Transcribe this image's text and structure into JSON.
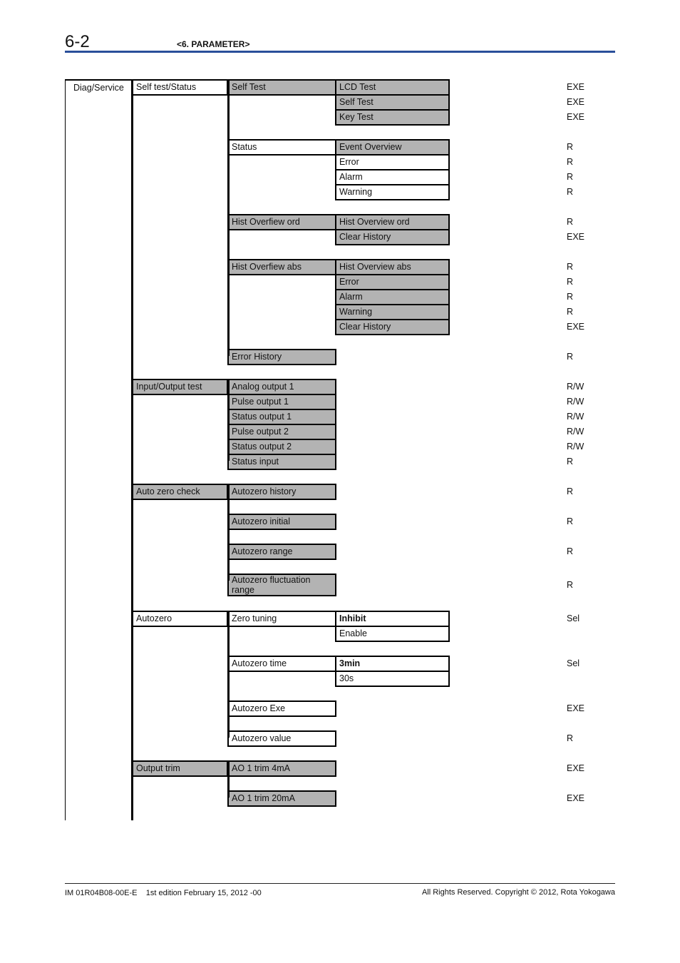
{
  "header": {
    "page_number": "6-2",
    "chapter": "<6. PARAMETER>"
  },
  "footer": {
    "document_id": "IM 01R04B08-00E-E    1st edition February 15, 2012 -00",
    "copyright": "All Rights Reserved. Copyright © 2012, Rota Yokogawa"
  },
  "colors": {
    "header_rule": "#2a4f9a",
    "menu_grey": "#b3b3b3"
  },
  "menu_tree": {
    "root": "Diag/Service",
    "level2": [
      {
        "label": "Self test/Status",
        "style": "white",
        "row": 0
      },
      {
        "label": "Input/Output test",
        "style": "grey",
        "row": 20
      },
      {
        "label": "Auto zero check",
        "style": "grey",
        "row": 27
      },
      {
        "label": "Autozero",
        "style": "white",
        "row": 35
      },
      {
        "label": "Output trim",
        "style": "grey",
        "row": 45
      }
    ],
    "level3": [
      {
        "label": "Self Test",
        "style": "grey",
        "row": 0
      },
      {
        "label": "Status",
        "style": "white",
        "row": 4
      },
      {
        "label": "Hist Overfiew ord",
        "style": "grey",
        "row": 9
      },
      {
        "label": "Hist Overfiew abs",
        "style": "grey",
        "row": 12
      },
      {
        "label": "Error History",
        "style": "grey",
        "row": 18
      },
      {
        "label": "Analog output 1",
        "style": "grey",
        "row": 20
      },
      {
        "label": "Pulse output 1",
        "style": "grey",
        "row": 21
      },
      {
        "label": "Status output 1",
        "style": "grey",
        "row": 22
      },
      {
        "label": "Pulse output 2",
        "style": "grey",
        "row": 23
      },
      {
        "label": "Status output 2",
        "style": "grey",
        "row": 24
      },
      {
        "label": "Status input",
        "style": "grey",
        "row": 25
      },
      {
        "label": "Autozero history",
        "style": "grey",
        "row": 27
      },
      {
        "label": "Autozero initial",
        "style": "grey",
        "row": 29
      },
      {
        "label": "Autozero range",
        "style": "grey",
        "row": 31
      },
      {
        "label": "Autozero fluctuation range",
        "style": "grey",
        "row": 33,
        "tall": true
      },
      {
        "label": "Zero tuning",
        "style": "white",
        "row": 35
      },
      {
        "label": "Autozero time",
        "style": "white",
        "row": 38
      },
      {
        "label": "Autozero Exe",
        "style": "white",
        "row": 41
      },
      {
        "label": "Autozero value",
        "style": "white",
        "row": 43
      },
      {
        "label": "AO 1 trim 4mA",
        "style": "grey",
        "row": 45
      },
      {
        "label": "AO 1 trim 20mA",
        "style": "grey",
        "row": 47
      }
    ],
    "level4": [
      {
        "label": "LCD Test",
        "style": "grey",
        "row": 0
      },
      {
        "label": "Self Test",
        "style": "grey",
        "row": 1
      },
      {
        "label": "Key Test",
        "style": "grey",
        "row": 2
      },
      {
        "label": "Event Overview",
        "style": "grey",
        "row": 4
      },
      {
        "label": "Error",
        "style": "white",
        "row": 5
      },
      {
        "label": "Alarm",
        "style": "white",
        "row": 6
      },
      {
        "label": "Warning",
        "style": "white",
        "row": 7
      },
      {
        "label": "Hist Overview ord",
        "style": "grey",
        "row": 9
      },
      {
        "label": "Clear History",
        "style": "grey",
        "row": 10
      },
      {
        "label": "Hist Overview abs",
        "style": "grey",
        "row": 12
      },
      {
        "label": "Error",
        "style": "grey",
        "row": 13
      },
      {
        "label": "Alarm",
        "style": "grey",
        "row": 14
      },
      {
        "label": "Warning",
        "style": "grey",
        "row": 15
      },
      {
        "label": "Clear History",
        "style": "grey",
        "row": 16
      },
      {
        "label": "Inhibit",
        "style": "white",
        "bold": true,
        "row": 35
      },
      {
        "label": "Enable",
        "style": "white",
        "row": 36
      },
      {
        "label": "3min",
        "style": "white",
        "bold": true,
        "row": 38
      },
      {
        "label": "30s",
        "style": "white",
        "row": 39
      }
    ],
    "access": [
      {
        "label": "EXE",
        "row": 0
      },
      {
        "label": "EXE",
        "row": 1
      },
      {
        "label": "EXE",
        "row": 2
      },
      {
        "label": "R",
        "row": 4
      },
      {
        "label": "R",
        "row": 5
      },
      {
        "label": "R",
        "row": 6
      },
      {
        "label": "R",
        "row": 7
      },
      {
        "label": "R",
        "row": 9
      },
      {
        "label": "EXE",
        "row": 10
      },
      {
        "label": "R",
        "row": 12
      },
      {
        "label": "R",
        "row": 13
      },
      {
        "label": "R",
        "row": 14
      },
      {
        "label": "R",
        "row": 15
      },
      {
        "label": "EXE",
        "row": 16
      },
      {
        "label": "R",
        "row": 18
      },
      {
        "label": "R/W",
        "row": 20
      },
      {
        "label": "R/W",
        "row": 21
      },
      {
        "label": "R/W",
        "row": 22
      },
      {
        "label": "R/W",
        "row": 23
      },
      {
        "label": "R/W",
        "row": 24
      },
      {
        "label": "R",
        "row": 25
      },
      {
        "label": "R",
        "row": 27
      },
      {
        "label": "R",
        "row": 29
      },
      {
        "label": "R",
        "row": 31
      },
      {
        "label": "R",
        "row": 33,
        "tall": true
      },
      {
        "label": "Sel",
        "row": 35
      },
      {
        "label": "Sel",
        "row": 38
      },
      {
        "label": "EXE",
        "row": 41
      },
      {
        "label": "R",
        "row": 43
      },
      {
        "label": "EXE",
        "row": 45
      },
      {
        "label": "EXE",
        "row": 47
      }
    ]
  }
}
